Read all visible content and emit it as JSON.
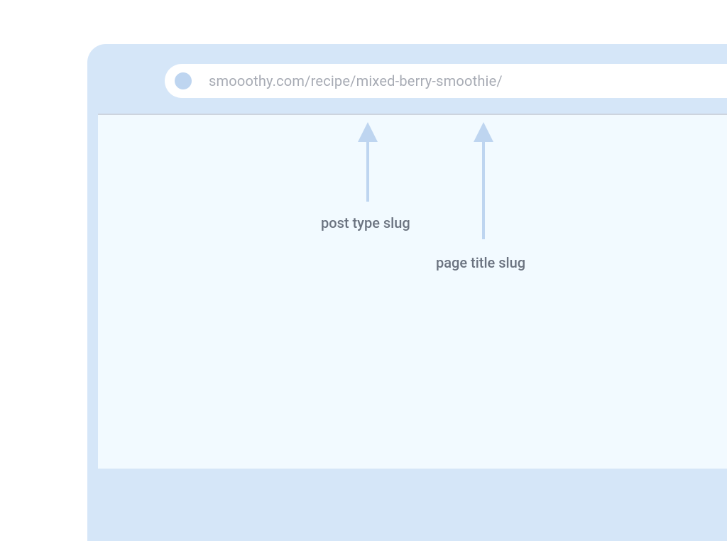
{
  "url": "smooothy.com/recipe/mixed-berry-smoothie/",
  "annotations": {
    "post_type": "post type slug",
    "page_title": "page title slug"
  },
  "colors": {
    "browser_chrome": "#d5e6f8",
    "content_bg": "#f2faff",
    "arrow": "#bed5f0",
    "label_text": "#6b7380",
    "url_text": "#a7abb4"
  }
}
